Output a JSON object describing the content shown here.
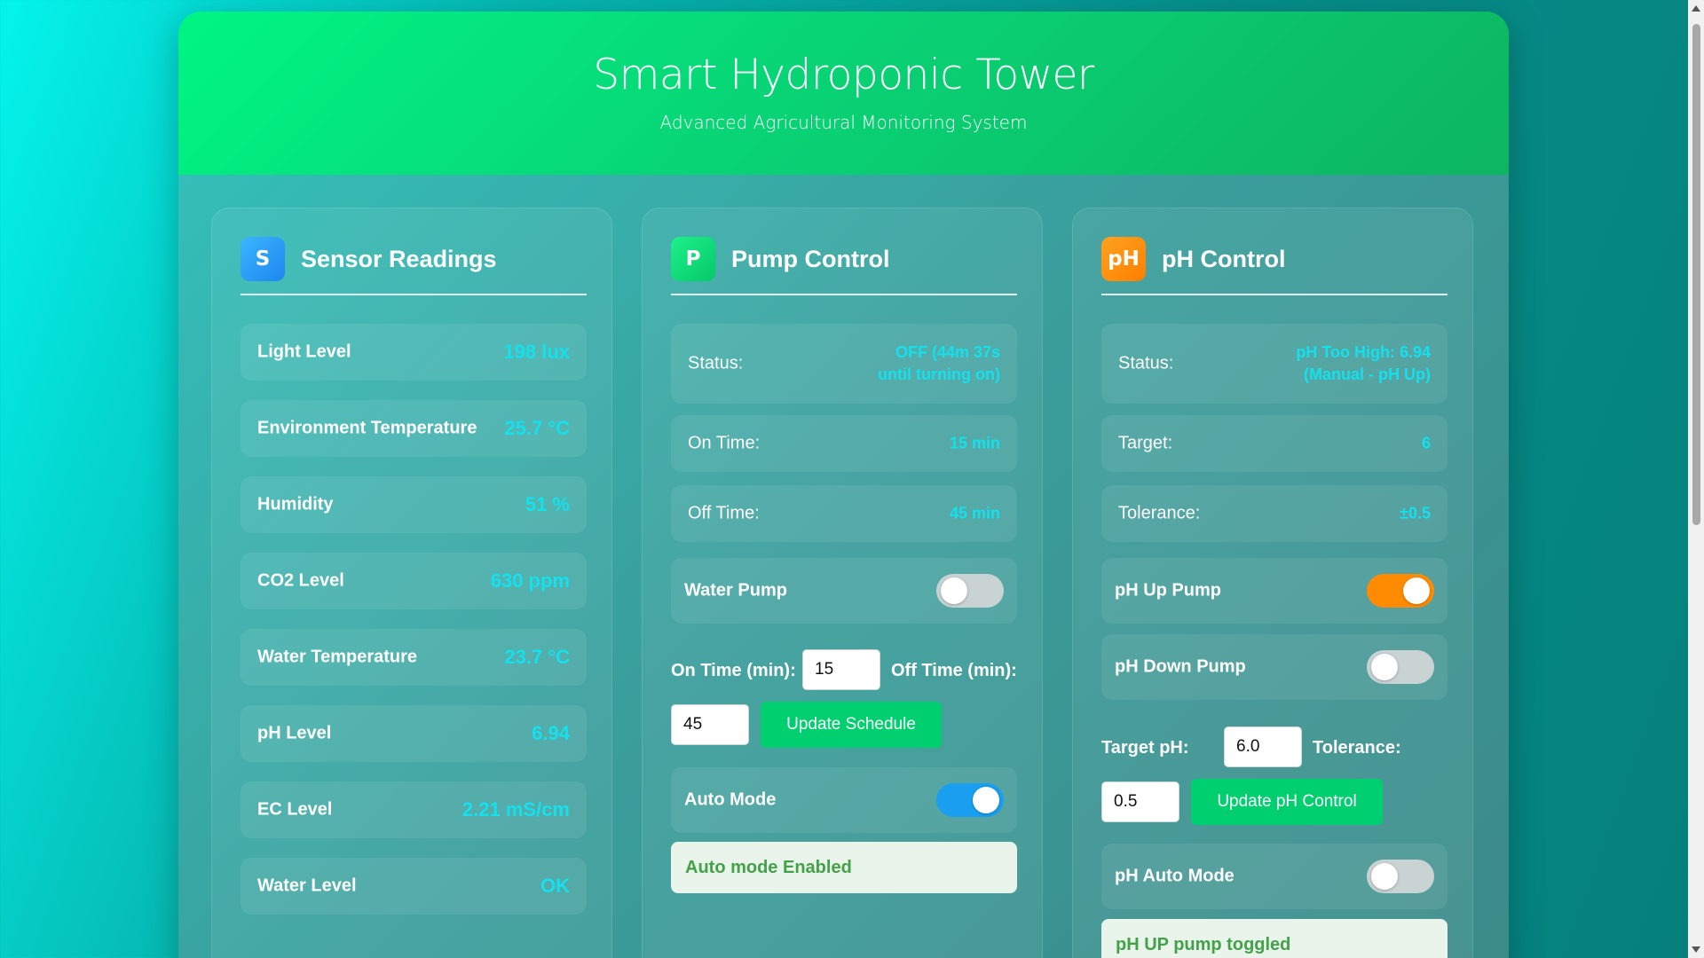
{
  "header": {
    "title": "Smart Hydroponic Tower",
    "subtitle": "Advanced Agricultural Monitoring System"
  },
  "sensors": {
    "icon_letter": "S",
    "title": "Sensor Readings",
    "items": [
      {
        "label": "Light Level",
        "value": "198 lux"
      },
      {
        "label": "Environment Temperature",
        "value": "25.7 °C"
      },
      {
        "label": "Humidity",
        "value": "51 %"
      },
      {
        "label": "CO2 Level",
        "value": "630 ppm"
      },
      {
        "label": "Water Temperature",
        "value": "23.7 °C"
      },
      {
        "label": "pH Level",
        "value": "6.94"
      },
      {
        "label": "EC Level",
        "value": "2.21 mS/cm"
      },
      {
        "label": "Water Level",
        "value": "OK"
      }
    ]
  },
  "pump": {
    "icon_letter": "P",
    "title": "Pump Control",
    "status_label": "Status:",
    "status_value": "OFF (44m 37s\nuntil turning on)",
    "on_time_label": "On Time:",
    "on_time_value": "15 min",
    "off_time_label": "Off Time:",
    "off_time_value": "45 min",
    "water_pump_label": "Water Pump",
    "water_pump_on": false,
    "on_time_input_label": "On Time (min):",
    "on_time_input_value": "15",
    "off_time_input_label": "Off Time (min):",
    "off_time_input_value": "45",
    "update_button": "Update Schedule",
    "auto_mode_label": "Auto Mode",
    "auto_mode_on": true,
    "message": "Auto mode Enabled"
  },
  "ph": {
    "icon_letter": "pH",
    "title": "pH Control",
    "status_label": "Status:",
    "status_value": "pH Too High: 6.94\n(Manual - pH Up)",
    "target_label": "Target:",
    "target_value": "6",
    "tolerance_label": "Tolerance:",
    "tolerance_value": "±0.5",
    "ph_up_label": "pH Up Pump",
    "ph_up_on": true,
    "ph_down_label": "pH Down Pump",
    "ph_down_on": false,
    "target_input_label": "Target pH:",
    "target_input_value": "6.0",
    "tolerance_input_label": "Tolerance:",
    "tolerance_input_value": "0.5",
    "update_button": "Update pH Control",
    "auto_mode_label": "pH Auto Mode",
    "auto_mode_on": false,
    "message": "pH UP pump toggled"
  },
  "colors": {
    "accent_value": "#14e0ee",
    "toggle_blue": "#1a9ff0",
    "toggle_orange": "#ff8c00",
    "button_green": "#00cf6f",
    "sensor_icon": "#1e90ff",
    "pump_icon": "#00d87a",
    "ph_icon": "#ff8c00"
  }
}
